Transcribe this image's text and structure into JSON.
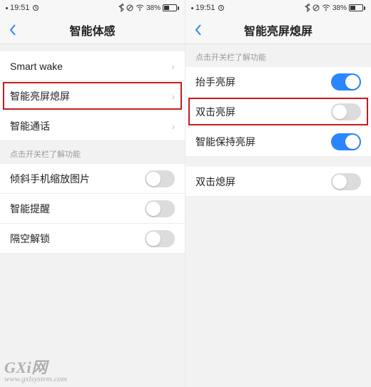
{
  "status": {
    "time": "19:51",
    "battery_pct": "38%",
    "icons": [
      "bluetooth",
      "dnd",
      "wifi"
    ]
  },
  "left": {
    "title": "智能体感",
    "rows_nav": [
      {
        "label": "Smart wake"
      },
      {
        "label": "智能亮屏熄屏",
        "highlighted": true
      },
      {
        "label": "智能通话"
      }
    ],
    "section_header": "点击开关栏了解功能",
    "rows_toggle": [
      {
        "label": "倾斜手机缩放图片",
        "on": false
      },
      {
        "label": "智能提醒",
        "on": false
      },
      {
        "label": "隔空解锁",
        "on": false
      }
    ]
  },
  "right": {
    "title": "智能亮屏熄屏",
    "section_header": "点击开关栏了解功能",
    "rows_group1": [
      {
        "label": "抬手亮屏",
        "on": true
      },
      {
        "label": "双击亮屏",
        "on": false,
        "highlighted": true
      },
      {
        "label": "智能保持亮屏",
        "on": true
      }
    ],
    "rows_group2": [
      {
        "label": "双击熄屏",
        "on": false
      }
    ]
  },
  "watermark": {
    "top": "GXi网",
    "bottom": "www.gxlsystem.com"
  }
}
